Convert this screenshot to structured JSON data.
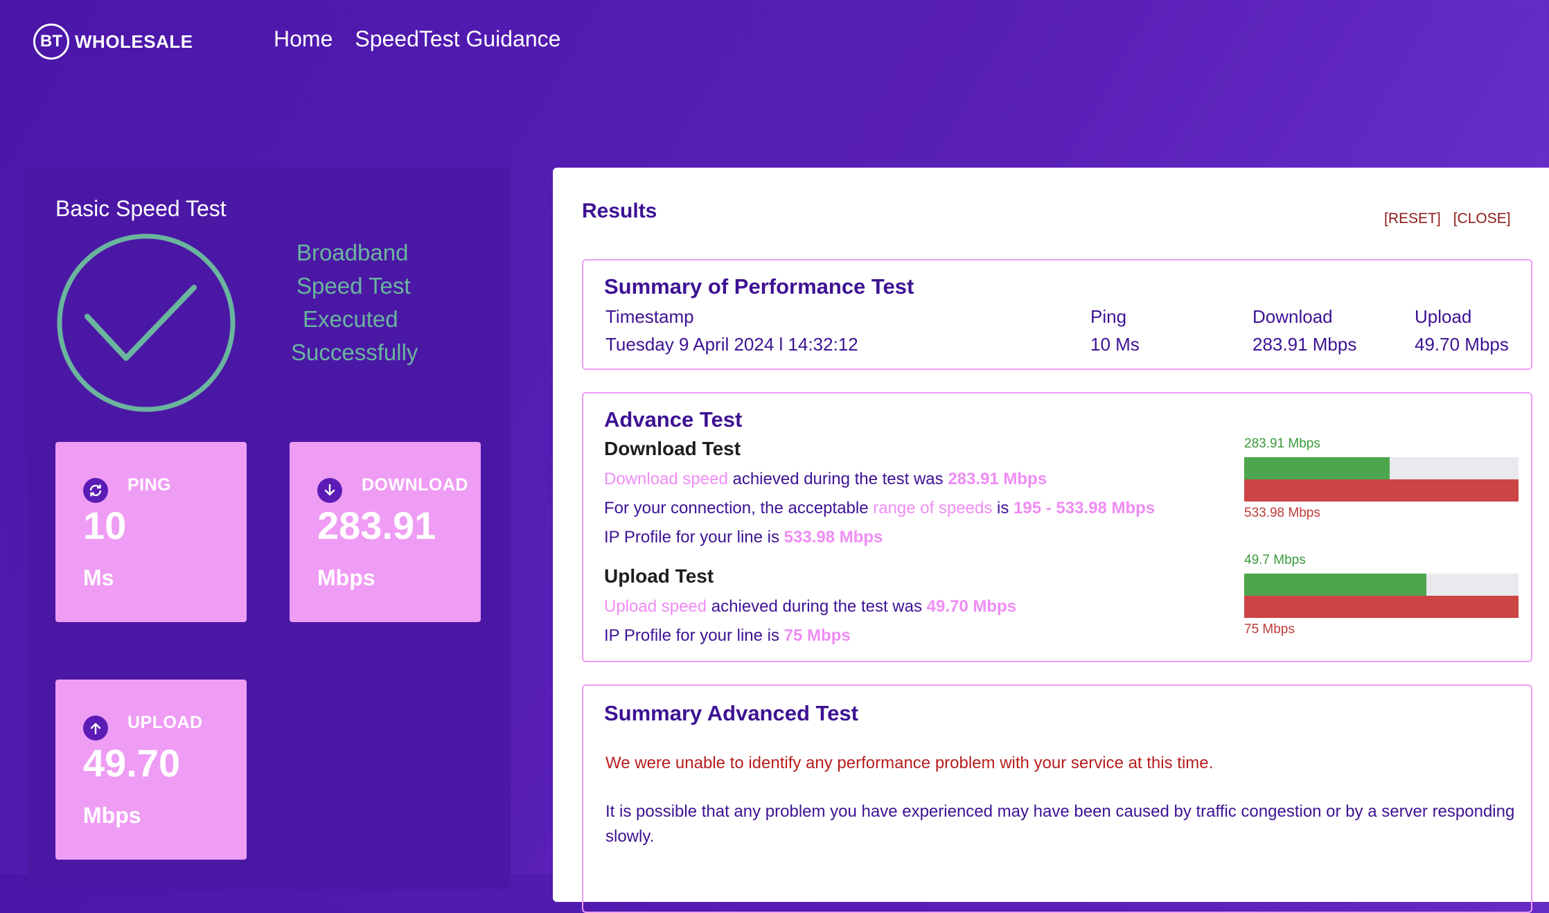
{
  "header": {
    "logo_mark": "BT",
    "logo_text": "WHOLESALE",
    "nav": [
      "Home",
      "SpeedTest Guidance"
    ]
  },
  "basic_test": {
    "title": "Basic Speed Test",
    "status_lines": [
      "Broadband",
      "Speed Test",
      "Executed",
      "Successfully"
    ],
    "tiles": {
      "ping": {
        "label": "PING",
        "value": "10",
        "unit": "Ms",
        "icon": "refresh-icon"
      },
      "download": {
        "label": "DOWNLOAD",
        "value": "283.91",
        "unit": "Mbps",
        "icon": "arrow-down-icon"
      },
      "upload": {
        "label": "UPLOAD",
        "value": "49.70",
        "unit": "Mbps",
        "icon": "arrow-up-icon"
      }
    }
  },
  "results": {
    "title": "Results",
    "reset_label": "[RESET]",
    "close_label": "[CLOSE]",
    "summary": {
      "title": "Summary of Performance Test",
      "headers": {
        "timestamp": "Timestamp",
        "ping": "Ping",
        "download": "Download",
        "upload": "Upload"
      },
      "values": {
        "timestamp": "Tuesday 9 April 2024 l 14:32:12",
        "ping": "10 Ms",
        "download": "283.91 Mbps",
        "upload": "49.70 Mbps"
      }
    },
    "advance": {
      "title": "Advance Test",
      "download": {
        "title": "Download Test",
        "l1_link": "Download speed",
        "l1_text": " achieved during the test was ",
        "l1_value": "283.91 Mbps",
        "l2_text1": "For your connection, the acceptable ",
        "l2_link": "range of speeds",
        "l2_text2": " is ",
        "l2_value": "195 - 533.98 Mbps",
        "l3_text": "IP Profile for your line is ",
        "l3_value": "533.98 Mbps",
        "bar_top_label": "283.91 Mbps",
        "bar_bottom_label": "533.98 Mbps",
        "fill_fraction": 0.53
      },
      "upload": {
        "title": "Upload Test",
        "l1_link": "Upload speed",
        "l1_text": " achieved during the test was ",
        "l1_value": "49.70 Mbps",
        "l2_text": "IP Profile for your line is ",
        "l2_value": "75 Mbps",
        "bar_top_label": "49.7 Mbps",
        "bar_bottom_label": "75 Mbps",
        "fill_fraction": 0.663
      }
    },
    "summary_advanced": {
      "title": "Summary Advanced Test",
      "message_red": "We were unable to identify any performance problem with your service at this time.",
      "message": "It is possible that any problem you have experienced may have been caused by traffic congestion or by a server responding slowly."
    }
  },
  "colors": {
    "accent_pink": "#ef9cf5",
    "brand_purple": "#3d1293",
    "bar_green": "#4da64d",
    "bar_red": "#cc4444",
    "check_teal": "#6ab59e"
  }
}
